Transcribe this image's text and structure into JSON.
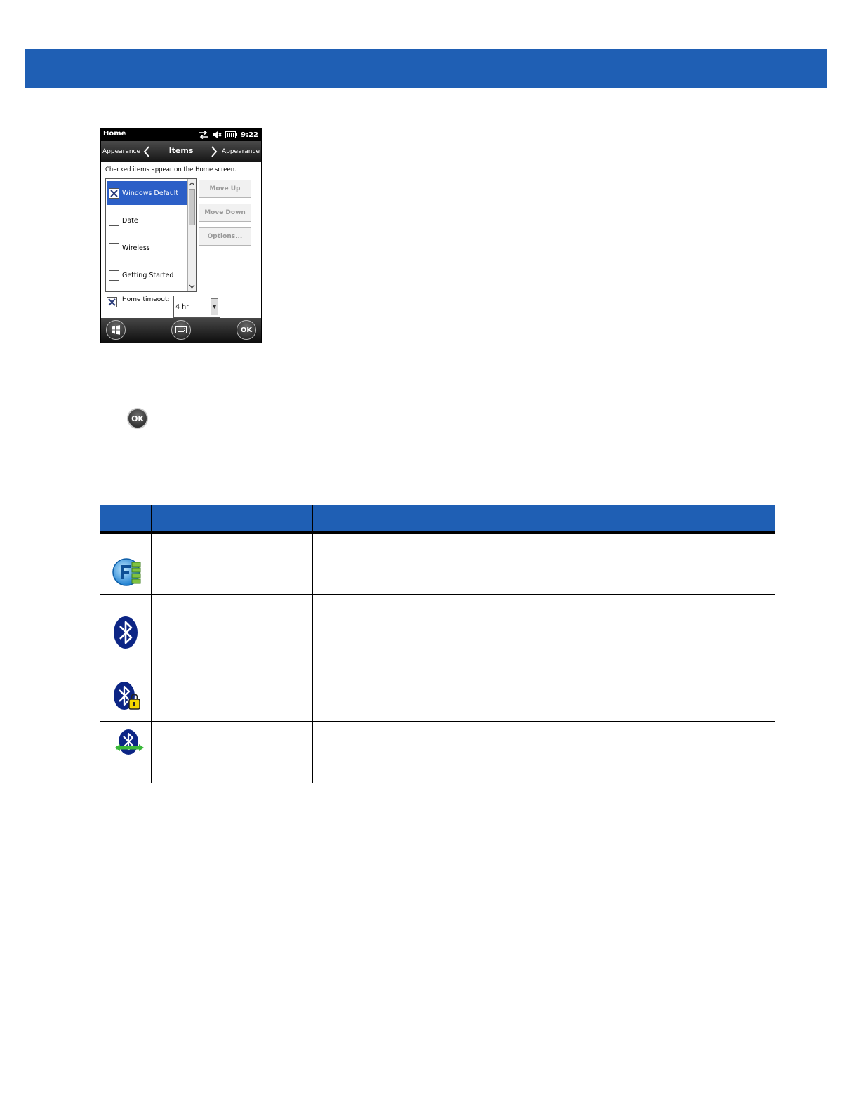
{
  "phone": {
    "status": {
      "title": "Home",
      "time": "9:22"
    },
    "nav": {
      "left": "Appearance",
      "title": "Items",
      "right": "Appearance"
    },
    "hint": "Checked items appear on the Home screen.",
    "items": [
      {
        "label": "Windows Default",
        "checked": true,
        "selected": true
      },
      {
        "label": "Date",
        "checked": false,
        "selected": false
      },
      {
        "label": "Wireless",
        "checked": false,
        "selected": false
      },
      {
        "label": "Getting Started",
        "checked": false,
        "selected": false
      }
    ],
    "buttons": {
      "move_up": "Move Up",
      "move_down": "Move Down",
      "options": "Options..."
    },
    "timeout": {
      "label": "Home timeout:",
      "value": "4 hr"
    },
    "softkeys": {
      "ok": "OK"
    }
  },
  "ok_button_label": "OK",
  "table": {
    "row_icons": [
      "fusion-signal-icon",
      "bluetooth-icon",
      "bluetooth-locked-icon",
      "bluetooth-connected-icon"
    ]
  },
  "colors": {
    "banner": "#1f5fb4",
    "selection": "#2c5fc7"
  }
}
